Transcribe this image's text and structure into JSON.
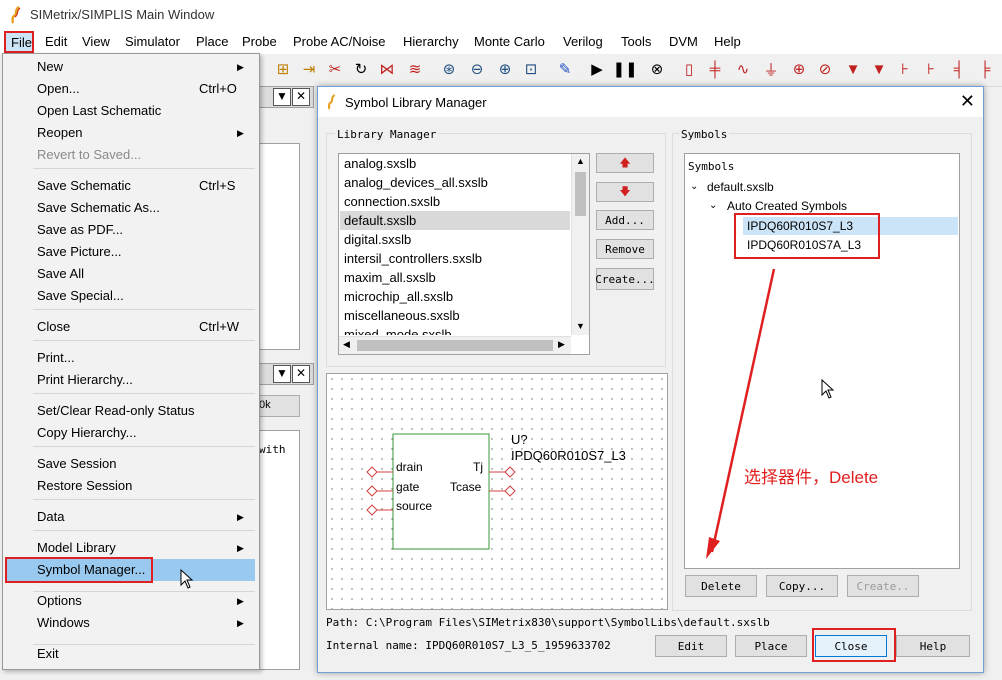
{
  "window": {
    "title": "SIMetrix/SIMPLIS Main Window"
  },
  "menubar": [
    "File",
    "Edit",
    "View",
    "Simulator",
    "Place",
    "Probe",
    "Probe AC/Noise",
    "Hierarchy",
    "Monte Carlo",
    "Verilog",
    "Tools",
    "DVM",
    "Help"
  ],
  "file_menu": {
    "items": [
      {
        "label": "New",
        "shortcut": "",
        "submenu": true,
        "disabled": false
      },
      {
        "label": "Open...",
        "shortcut": "Ctrl+O",
        "submenu": false,
        "disabled": false
      },
      {
        "label": "Open Last Schematic",
        "shortcut": "",
        "submenu": false,
        "disabled": false
      },
      {
        "label": "Reopen",
        "shortcut": "",
        "submenu": true,
        "disabled": false
      },
      {
        "label": "Revert to Saved...",
        "shortcut": "",
        "submenu": false,
        "disabled": true
      },
      {
        "label": "Save Schematic",
        "shortcut": "Ctrl+S",
        "submenu": false,
        "disabled": false
      },
      {
        "label": "Save Schematic As...",
        "shortcut": "",
        "submenu": false,
        "disabled": false
      },
      {
        "label": "Save as PDF...",
        "shortcut": "",
        "submenu": false,
        "disabled": false
      },
      {
        "label": "Save Picture...",
        "shortcut": "",
        "submenu": false,
        "disabled": false
      },
      {
        "label": "Save All",
        "shortcut": "",
        "submenu": false,
        "disabled": false
      },
      {
        "label": "Save Special...",
        "shortcut": "",
        "submenu": false,
        "disabled": false
      },
      {
        "label": "Close",
        "shortcut": "Ctrl+W",
        "submenu": false,
        "disabled": false
      },
      {
        "label": "Print...",
        "shortcut": "",
        "submenu": false,
        "disabled": false
      },
      {
        "label": "Print Hierarchy...",
        "shortcut": "",
        "submenu": false,
        "disabled": false
      },
      {
        "label": "Set/Clear Read-only Status",
        "shortcut": "",
        "submenu": false,
        "disabled": false
      },
      {
        "label": "Copy Hierarchy...",
        "shortcut": "",
        "submenu": false,
        "disabled": false
      },
      {
        "label": "Save Session",
        "shortcut": "",
        "submenu": false,
        "disabled": false
      },
      {
        "label": "Restore Session",
        "shortcut": "",
        "submenu": false,
        "disabled": false
      },
      {
        "label": "Data",
        "shortcut": "",
        "submenu": true,
        "disabled": false
      },
      {
        "label": "Model Library",
        "shortcut": "",
        "submenu": true,
        "disabled": false
      },
      {
        "label": "Symbol Manager...",
        "shortcut": "",
        "submenu": false,
        "disabled": false
      },
      {
        "label": "Options",
        "shortcut": "",
        "submenu": true,
        "disabled": false
      },
      {
        "label": "Windows",
        "shortcut": "",
        "submenu": true,
        "disabled": false
      },
      {
        "label": "Exit",
        "shortcut": "",
        "submenu": false,
        "disabled": false
      }
    ]
  },
  "background": {
    "frag_ok": "0k",
    "frag_with": "with"
  },
  "dialog": {
    "title": "Symbol Library Manager",
    "library_group": "Library Manager",
    "libraries": [
      "analog.sxslb",
      "analog_devices_all.sxslb",
      "connection.sxslb",
      "default.sxslb",
      "digital.sxslb",
      "intersil_controllers.sxslb",
      "maxim_all.sxslb",
      "microchip_all.sxslb",
      "miscellaneous.sxslb",
      "mixed_mode.sxslb"
    ],
    "selected_library": "default.sxslb",
    "lib_buttons": {
      "add": "Add...",
      "remove": "Remove",
      "create": "Create..."
    },
    "symbols_group": "Symbols",
    "tree": {
      "root_label": "Symbols",
      "library": "default.sxslb",
      "folder": "Auto Created Symbols",
      "symbols": [
        "IPDQ60R010S7_L3",
        "IPDQ60R010S7A_L3"
      ]
    },
    "selected_symbol": "IPDQ60R010S7_L3",
    "preview": {
      "ref": "U?",
      "name": "IPDQ60R010S7_L3",
      "pins_left": [
        "drain",
        "gate",
        "source"
      ],
      "pins_right": [
        "Tj",
        "Tcase"
      ]
    },
    "annotation": "选择器件，Delete",
    "sym_buttons": {
      "delete": "Delete",
      "copy": "Copy...",
      "create": "Create.."
    },
    "path": "Path: C:\\Program Files\\SIMetrix830\\support\\SymbolLibs\\default.sxslb",
    "internal_name": "Internal name: IPDQ60R010S7_L3_5_1959633702",
    "bottom_buttons": {
      "edit": "Edit",
      "place": "Place",
      "close": "Close",
      "help": "Help"
    }
  },
  "colors": {
    "highlight": "#e02020",
    "selection": "#99c9ef",
    "symbol_body": "#3a9a3a",
    "pin_marker": "#d04040"
  }
}
